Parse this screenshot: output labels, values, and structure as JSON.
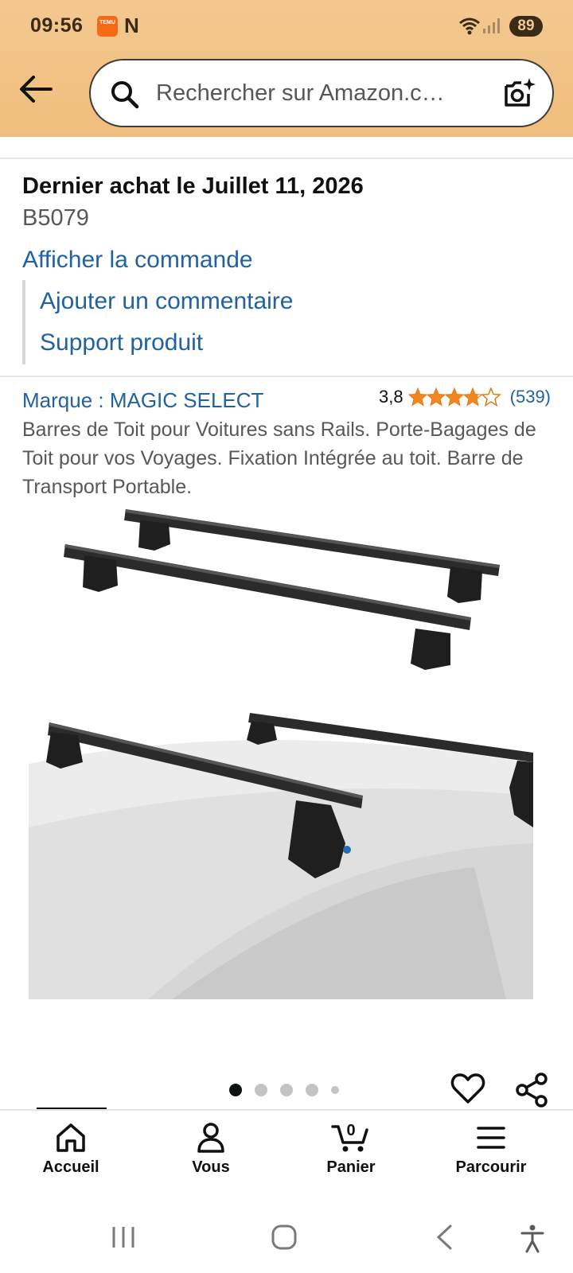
{
  "status_bar": {
    "time": "09:56",
    "app_icon_label": "TEMU",
    "notification_icon": "N",
    "battery": "89"
  },
  "header": {
    "back_icon": "arrow-left-icon",
    "search_placeholder": "Rechercher sur Amazon.c…",
    "search_icon": "search-icon",
    "camera_icon": "camera-sparkle-icon"
  },
  "order": {
    "title": "Dernier achat le Juillet 11, 2026",
    "id": "B5079",
    "view_order": "Afficher la commande",
    "add_comment": "Ajouter un commentaire",
    "product_support": "Support produit"
  },
  "product": {
    "brand": "Marque : MAGIC SELECT",
    "rating_value": "3,8",
    "rating_stars": 3.8,
    "review_count": "(539)",
    "description": "Barres de Toit pour Voitures sans Rails. Porte-Bagages de Toit pour vos Voyages. Fixation Intégrée au toit. Barre de Transport Portable.",
    "image_count": 5,
    "active_image": 1
  },
  "bottom_nav": {
    "items": [
      {
        "label": "Accueil",
        "icon": "home-icon"
      },
      {
        "label": "Vous",
        "icon": "user-icon"
      },
      {
        "label": "Panier",
        "icon": "cart-icon",
        "count": "0"
      },
      {
        "label": "Parcourir",
        "icon": "menu-icon"
      }
    ]
  },
  "colors": {
    "header_bg": "#f3c88f",
    "link": "#2162a1",
    "star": "#f3861f"
  }
}
